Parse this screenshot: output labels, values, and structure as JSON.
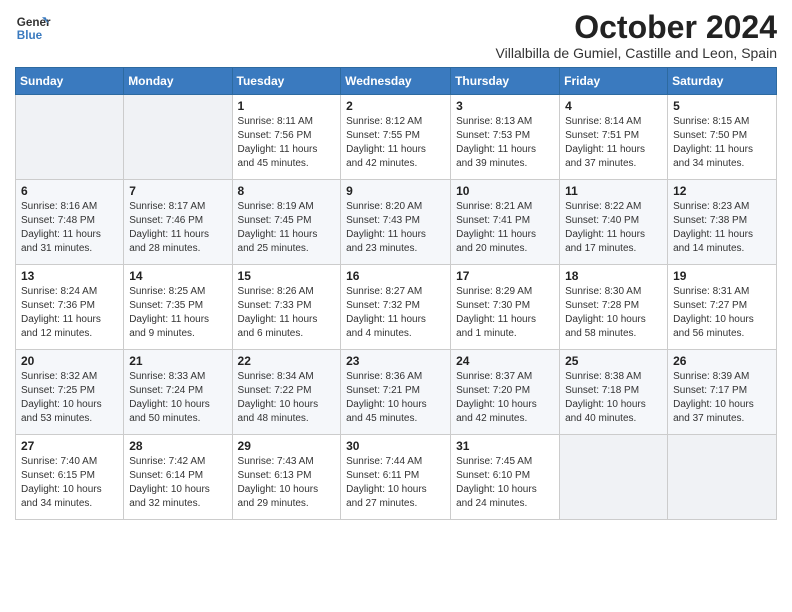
{
  "header": {
    "logo_line1": "General",
    "logo_line2": "Blue",
    "month": "October 2024",
    "location": "Villalbilla de Gumiel, Castille and Leon, Spain"
  },
  "weekdays": [
    "Sunday",
    "Monday",
    "Tuesday",
    "Wednesday",
    "Thursday",
    "Friday",
    "Saturday"
  ],
  "weeks": [
    [
      {
        "day": "",
        "info": ""
      },
      {
        "day": "",
        "info": ""
      },
      {
        "day": "1",
        "info": "Sunrise: 8:11 AM\nSunset: 7:56 PM\nDaylight: 11 hours\nand 45 minutes."
      },
      {
        "day": "2",
        "info": "Sunrise: 8:12 AM\nSunset: 7:55 PM\nDaylight: 11 hours\nand 42 minutes."
      },
      {
        "day": "3",
        "info": "Sunrise: 8:13 AM\nSunset: 7:53 PM\nDaylight: 11 hours\nand 39 minutes."
      },
      {
        "day": "4",
        "info": "Sunrise: 8:14 AM\nSunset: 7:51 PM\nDaylight: 11 hours\nand 37 minutes."
      },
      {
        "day": "5",
        "info": "Sunrise: 8:15 AM\nSunset: 7:50 PM\nDaylight: 11 hours\nand 34 minutes."
      }
    ],
    [
      {
        "day": "6",
        "info": "Sunrise: 8:16 AM\nSunset: 7:48 PM\nDaylight: 11 hours\nand 31 minutes."
      },
      {
        "day": "7",
        "info": "Sunrise: 8:17 AM\nSunset: 7:46 PM\nDaylight: 11 hours\nand 28 minutes."
      },
      {
        "day": "8",
        "info": "Sunrise: 8:19 AM\nSunset: 7:45 PM\nDaylight: 11 hours\nand 25 minutes."
      },
      {
        "day": "9",
        "info": "Sunrise: 8:20 AM\nSunset: 7:43 PM\nDaylight: 11 hours\nand 23 minutes."
      },
      {
        "day": "10",
        "info": "Sunrise: 8:21 AM\nSunset: 7:41 PM\nDaylight: 11 hours\nand 20 minutes."
      },
      {
        "day": "11",
        "info": "Sunrise: 8:22 AM\nSunset: 7:40 PM\nDaylight: 11 hours\nand 17 minutes."
      },
      {
        "day": "12",
        "info": "Sunrise: 8:23 AM\nSunset: 7:38 PM\nDaylight: 11 hours\nand 14 minutes."
      }
    ],
    [
      {
        "day": "13",
        "info": "Sunrise: 8:24 AM\nSunset: 7:36 PM\nDaylight: 11 hours\nand 12 minutes."
      },
      {
        "day": "14",
        "info": "Sunrise: 8:25 AM\nSunset: 7:35 PM\nDaylight: 11 hours\nand 9 minutes."
      },
      {
        "day": "15",
        "info": "Sunrise: 8:26 AM\nSunset: 7:33 PM\nDaylight: 11 hours\nand 6 minutes."
      },
      {
        "day": "16",
        "info": "Sunrise: 8:27 AM\nSunset: 7:32 PM\nDaylight: 11 hours\nand 4 minutes."
      },
      {
        "day": "17",
        "info": "Sunrise: 8:29 AM\nSunset: 7:30 PM\nDaylight: 11 hours\nand 1 minute."
      },
      {
        "day": "18",
        "info": "Sunrise: 8:30 AM\nSunset: 7:28 PM\nDaylight: 10 hours\nand 58 minutes."
      },
      {
        "day": "19",
        "info": "Sunrise: 8:31 AM\nSunset: 7:27 PM\nDaylight: 10 hours\nand 56 minutes."
      }
    ],
    [
      {
        "day": "20",
        "info": "Sunrise: 8:32 AM\nSunset: 7:25 PM\nDaylight: 10 hours\nand 53 minutes."
      },
      {
        "day": "21",
        "info": "Sunrise: 8:33 AM\nSunset: 7:24 PM\nDaylight: 10 hours\nand 50 minutes."
      },
      {
        "day": "22",
        "info": "Sunrise: 8:34 AM\nSunset: 7:22 PM\nDaylight: 10 hours\nand 48 minutes."
      },
      {
        "day": "23",
        "info": "Sunrise: 8:36 AM\nSunset: 7:21 PM\nDaylight: 10 hours\nand 45 minutes."
      },
      {
        "day": "24",
        "info": "Sunrise: 8:37 AM\nSunset: 7:20 PM\nDaylight: 10 hours\nand 42 minutes."
      },
      {
        "day": "25",
        "info": "Sunrise: 8:38 AM\nSunset: 7:18 PM\nDaylight: 10 hours\nand 40 minutes."
      },
      {
        "day": "26",
        "info": "Sunrise: 8:39 AM\nSunset: 7:17 PM\nDaylight: 10 hours\nand 37 minutes."
      }
    ],
    [
      {
        "day": "27",
        "info": "Sunrise: 7:40 AM\nSunset: 6:15 PM\nDaylight: 10 hours\nand 34 minutes."
      },
      {
        "day": "28",
        "info": "Sunrise: 7:42 AM\nSunset: 6:14 PM\nDaylight: 10 hours\nand 32 minutes."
      },
      {
        "day": "29",
        "info": "Sunrise: 7:43 AM\nSunset: 6:13 PM\nDaylight: 10 hours\nand 29 minutes."
      },
      {
        "day": "30",
        "info": "Sunrise: 7:44 AM\nSunset: 6:11 PM\nDaylight: 10 hours\nand 27 minutes."
      },
      {
        "day": "31",
        "info": "Sunrise: 7:45 AM\nSunset: 6:10 PM\nDaylight: 10 hours\nand 24 minutes."
      },
      {
        "day": "",
        "info": ""
      },
      {
        "day": "",
        "info": ""
      }
    ]
  ]
}
